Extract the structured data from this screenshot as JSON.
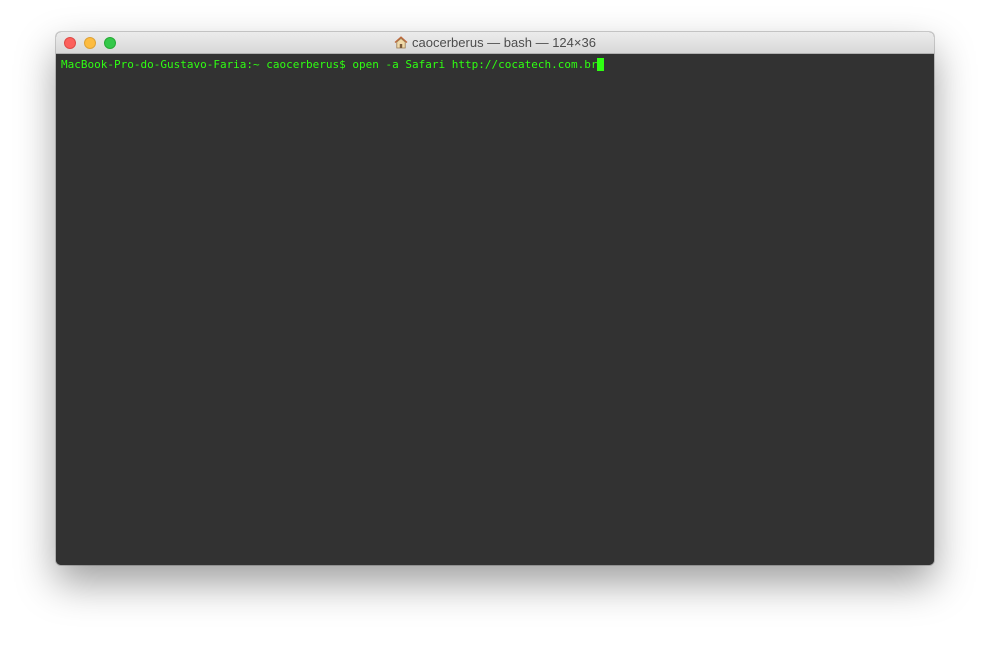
{
  "window": {
    "title": "caocerberus — bash — 124×36",
    "title_icon": "home-icon"
  },
  "terminal": {
    "prompt": "MacBook-Pro-do-Gustavo-Faria:~ caocerberus$ ",
    "command": "open -a Safari http://cocatech.com.br"
  },
  "colors": {
    "terminal_background": "#323232",
    "terminal_text": "#2fff12",
    "close": "#fc605c",
    "minimize": "#fdbc40",
    "zoom": "#34c84a"
  }
}
